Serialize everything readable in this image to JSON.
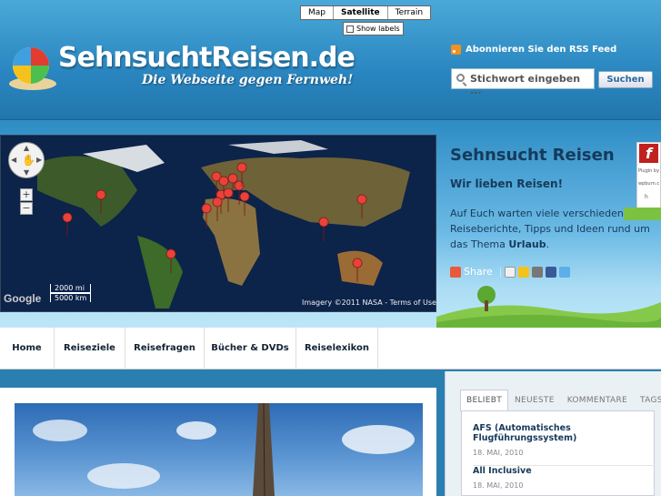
{
  "header": {
    "site_title": "SehnsuchtReisen.de",
    "tagline": "Die Webseite gegen Fernweh!",
    "rss_label": "Abonnieren Sie den RSS Feed",
    "search_placeholder": "Stichwort eingeben ...",
    "search_button": "Suchen"
  },
  "map": {
    "types": [
      "Map",
      "Satellite",
      "Terrain"
    ],
    "active_type": "Satellite",
    "show_labels": "Show labels",
    "scale_mi": "2000 mi",
    "scale_km": "5000 km",
    "google_logo": "Google",
    "attribution": "Imagery ©2011 NASA - Terms of Use"
  },
  "panel": {
    "title": "Sehnsucht Reisen",
    "subtitle": "Wir lieben Reisen!",
    "text": "Auf Euch warten viele verschiedene Reiseberichte, Tipps und Ideen rund um das Thema",
    "text_bold": "Urlaub",
    "text_end": ".",
    "share_label": "Share"
  },
  "flash": {
    "label_1": "Plugin by",
    "label_2": "wpburn.c",
    "label_3": "h"
  },
  "nav": {
    "items": [
      "Home",
      "Reiseziele",
      "Reisefragen",
      "Bücher & DVDs",
      "Reiselexikon"
    ]
  },
  "sidebar": {
    "tabs": [
      "BELIEBT",
      "NEUESTE",
      "KOMMENTARE",
      "TAGS"
    ],
    "active_tab": "BELIEBT",
    "posts": [
      {
        "title": "AFS (Automatisches Flugführungssystem)",
        "date": "18. MAI, 2010"
      },
      {
        "title": "All Inclusive",
        "date": "18. MAI, 2010"
      }
    ]
  },
  "colors": {
    "header_blue": "#2a86c0",
    "title_dark": "#163a5a",
    "pin_red": "#e8423a"
  }
}
